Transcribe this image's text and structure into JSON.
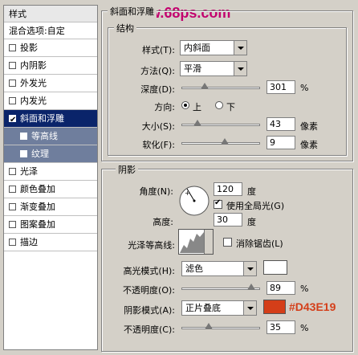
{
  "sidebar": {
    "title": "样式",
    "blend_options": "混合选项:自定",
    "items": [
      {
        "label": "投影",
        "checked": false
      },
      {
        "label": "内阴影",
        "checked": false
      },
      {
        "label": "外发光",
        "checked": false
      },
      {
        "label": "内发光",
        "checked": false
      },
      {
        "label": "斜面和浮雕",
        "checked": true
      },
      {
        "label": "等高线",
        "checked": false
      },
      {
        "label": "纹理",
        "checked": false
      },
      {
        "label": "光泽",
        "checked": false
      },
      {
        "label": "颜色叠加",
        "checked": false
      },
      {
        "label": "渐变叠加",
        "checked": false
      },
      {
        "label": "图案叠加",
        "checked": false
      },
      {
        "label": "描边",
        "checked": false
      }
    ]
  },
  "watermark": "www.68ps.com",
  "bevel": {
    "panel_title": "斜面和浮雕",
    "structure_title": "结构",
    "style_label": "样式(T):",
    "style_value": "内斜面",
    "method_label": "方法(Q):",
    "method_value": "平滑",
    "depth_label": "深度(D):",
    "depth_value": "301",
    "depth_unit": "%",
    "depth_level": 0.3,
    "direction_label": "方向:",
    "direction_up": "上",
    "direction_down": "下",
    "direction_selected": "上",
    "size_label": "大小(S):",
    "size_value": "43",
    "size_unit": "像素",
    "size_level": 0.2,
    "soften_label": "软化(F):",
    "soften_value": "9",
    "soften_unit": "像素",
    "soften_level": 0.55
  },
  "shading": {
    "title": "阴影",
    "angle_label": "角度(N):",
    "angle_value": "120",
    "angle_unit": "度",
    "global_light_label": "使用全局光(G)",
    "global_light_checked": true,
    "altitude_label": "高度:",
    "altitude_value": "30",
    "altitude_unit": "度",
    "gloss_contour_label": "光泽等高线:",
    "anti_alias_label": "消除锯齿(L)",
    "anti_alias_checked": false,
    "highlight_mode_label": "高光模式(H):",
    "highlight_mode_value": "滤色",
    "highlight_color": "#ffffff",
    "highlight_opacity_label": "不透明度(O):",
    "highlight_opacity_value": "89",
    "highlight_opacity_unit": "%",
    "highlight_opacity_level": 0.89,
    "shadow_mode_label": "阴影模式(A):",
    "shadow_mode_value": "正片叠底",
    "shadow_color": "#D43E19",
    "shadow_color_label": "#D43E19",
    "shadow_opacity_label": "不透明度(C):",
    "shadow_opacity_value": "35",
    "shadow_opacity_unit": "%",
    "shadow_opacity_level": 0.35
  }
}
